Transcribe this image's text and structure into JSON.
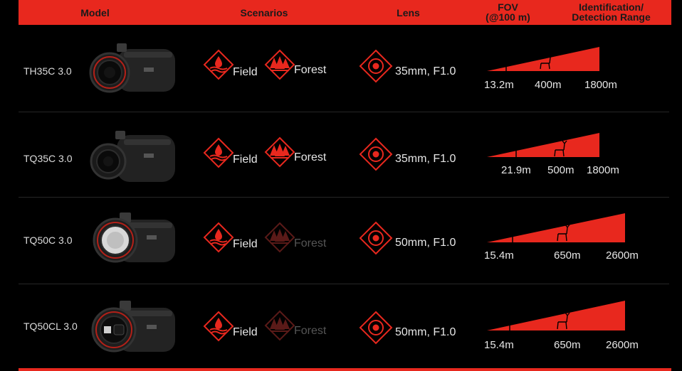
{
  "header": {
    "model": "Model",
    "scenarios": "Scenarios",
    "lens": "Lens",
    "fov_line1": "FOV",
    "fov_line2": "(@100 m)",
    "range_line1": "Identification/",
    "range_line2": "Detection Range"
  },
  "colors": {
    "accent": "#e8281e",
    "background": "#000000",
    "muted_icon": "#5a1a18"
  },
  "rows": [
    {
      "model": "TH35C 3.0",
      "scenario_1": "Field",
      "scenario_2": "Forest",
      "scenario_2_active": true,
      "lens": "35mm, F1.0",
      "fov": "13.2m",
      "identification": "400m",
      "detection": "1800m"
    },
    {
      "model": "TQ35C 3.0",
      "scenario_1": "Field",
      "scenario_2": "Forest",
      "scenario_2_active": true,
      "lens": "35mm, F1.0",
      "fov": "21.9m",
      "identification": "500m",
      "detection": "1800m"
    },
    {
      "model": "TQ50C 3.0",
      "scenario_1": "Field",
      "scenario_2": "Forest",
      "scenario_2_active": false,
      "lens": "50mm, F1.0",
      "fov": "15.4m",
      "identification": "650m",
      "detection": "2600m"
    },
    {
      "model": "TQ50CL 3.0",
      "scenario_1": "Field",
      "scenario_2": "Forest",
      "scenario_2_active": false,
      "lens": "50mm, F1.0",
      "fov": "15.4m",
      "identification": "650m",
      "detection": "2600m"
    }
  ]
}
